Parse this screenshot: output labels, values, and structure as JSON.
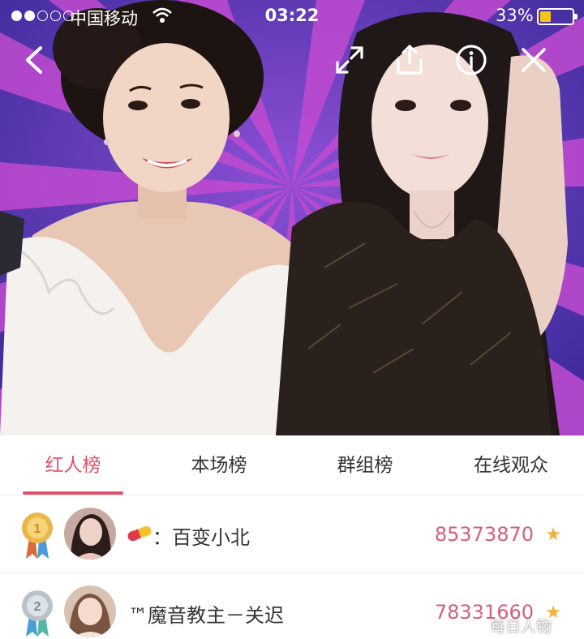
{
  "status_bar": {
    "signal_dots_filled": 2,
    "signal_dots_total": 5,
    "carrier": "中国移动",
    "time": "03:22",
    "battery_percent_label": "33%",
    "battery_level": 0.33,
    "battery_color": "#f5c518"
  },
  "toolbar": {
    "back_icon": "chevron-left-icon",
    "expand_icon": "expand-icon",
    "share_icon": "share-icon",
    "info_icon": "info-icon",
    "close_icon": "close-icon"
  },
  "tabs": [
    {
      "label": "红人榜",
      "active": true
    },
    {
      "label": "本场榜",
      "active": false
    },
    {
      "label": "群组榜",
      "active": false
    },
    {
      "label": "在线观众",
      "active": false
    }
  ],
  "ranking": [
    {
      "rank": 1,
      "badge": "pill-icon",
      "name": "：百变小北",
      "score": "85373870",
      "star": "★",
      "medal_color": "#e9b74a"
    },
    {
      "rank": 2,
      "badge": "",
      "name": "™魔音教主－关迟",
      "score": "78331660",
      "star": "★",
      "medal_color": "#b9c2c9"
    }
  ],
  "watermark": "每日人物",
  "colors": {
    "accent": "#e0506d",
    "score": "#d4607c",
    "star": "#f0b13a"
  }
}
